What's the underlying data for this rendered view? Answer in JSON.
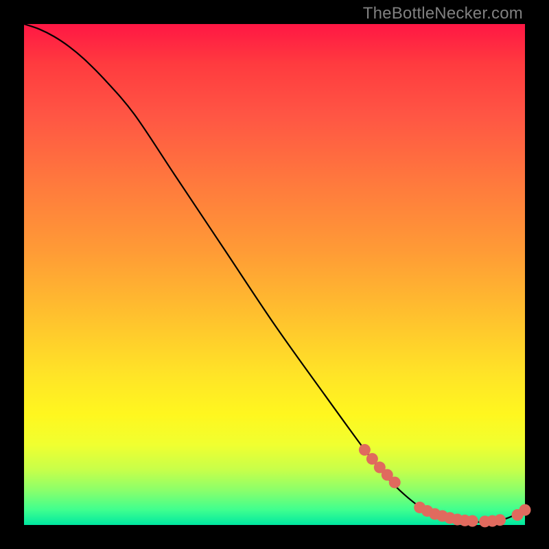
{
  "attribution": "TheBottleNecker.com",
  "colors": {
    "background": "#000000",
    "gradient_top": "#ff1744",
    "gradient_bottom": "#00e8a0",
    "curve": "#000000",
    "marker": "#e06a5e"
  },
  "chart_data": {
    "type": "line",
    "title": "",
    "xlabel": "",
    "ylabel": "",
    "xlim": [
      0,
      100
    ],
    "ylim": [
      0,
      100
    ],
    "grid": false,
    "legend": false,
    "series": [
      {
        "name": "curve",
        "x": [
          0,
          3,
          6,
          9,
          12,
          16,
          22,
          30,
          40,
          50,
          60,
          68,
          72,
          76,
          80,
          84,
          88,
          92,
          96,
          100
        ],
        "values": [
          100,
          99,
          97.5,
          95.5,
          93,
          89,
          82,
          70,
          55,
          40,
          26,
          15,
          10,
          6,
          3,
          1.5,
          0.8,
          0.6,
          1.2,
          3
        ]
      }
    ],
    "markers": {
      "name": "highlighted-points",
      "x": [
        68,
        69.5,
        71,
        72.5,
        74,
        79,
        80.5,
        82,
        83.5,
        85,
        86.5,
        88,
        89.5,
        92,
        93.5,
        95,
        98.5,
        100
      ],
      "values": [
        15,
        13.2,
        11.5,
        10,
        8.5,
        3.5,
        2.8,
        2.2,
        1.8,
        1.4,
        1.1,
        0.9,
        0.8,
        0.7,
        0.8,
        1.0,
        2.0,
        3
      ]
    }
  }
}
